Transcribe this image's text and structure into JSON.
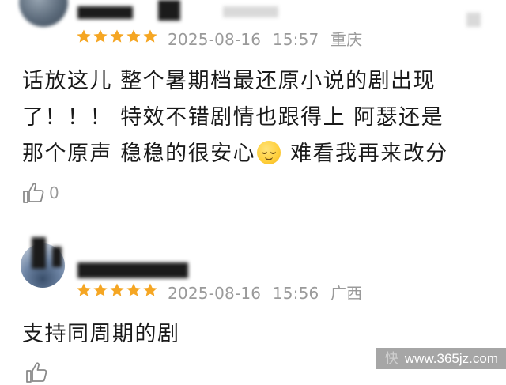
{
  "comments": [
    {
      "username": "███",
      "date": "2025-08-16",
      "time": "15:57",
      "location": "重庆",
      "stars": 5,
      "lines": [
        "话放这儿 整个暑期档最还原小说的剧出现",
        "了！！！ 特效不错剧情也跟得上 阿瑟还是",
        "那个原声 稳稳的很安心",
        "难看我再来改分"
      ],
      "likes": "0"
    },
    {
      "username": "███",
      "date": "2025-08-16",
      "time": "15:56",
      "location": "广西",
      "stars": 5,
      "lines": [
        "支持同周期的剧"
      ],
      "likes": ""
    }
  ],
  "watermark": {
    "faded": "快",
    "text": "www.365jz.com"
  },
  "colors": {
    "star": "#f5a623",
    "meta": "#9a9a9a"
  },
  "icons": {
    "star": "star-icon",
    "like": "thumbs-up-icon",
    "emoji": "relieved-face-emoji"
  }
}
